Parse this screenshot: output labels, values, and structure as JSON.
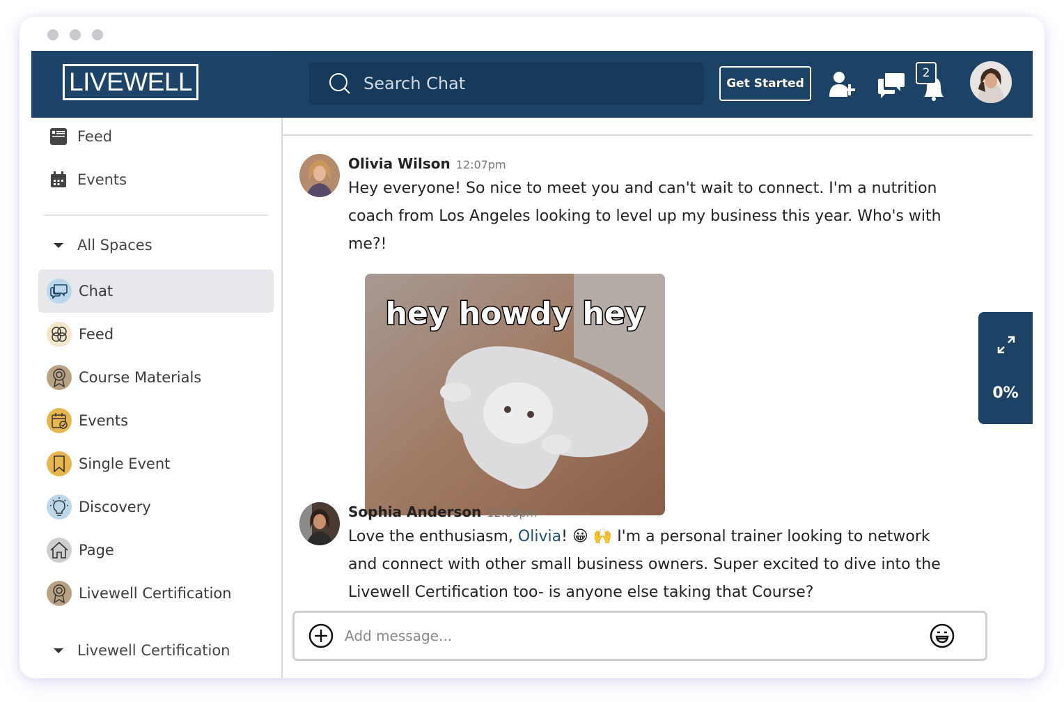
{
  "header": {
    "logo_text": "LIVEWELL",
    "search_placeholder": "Search Chat",
    "get_started_label": "Get Started",
    "notification_count": "2"
  },
  "sidebar": {
    "top_items": [
      {
        "label": "Feed",
        "icon": "newspaper-icon"
      },
      {
        "label": "Events",
        "icon": "calendar-icon"
      }
    ],
    "section_label": "All Spaces",
    "spaces": [
      {
        "label": "Chat",
        "icon": "chat-bubbles-icon",
        "active": true
      },
      {
        "label": "Feed",
        "icon": "clover-icon"
      },
      {
        "label": "Course Materials",
        "icon": "award-ribbon-icon"
      },
      {
        "label": "Events",
        "icon": "calendar-check-icon"
      },
      {
        "label": "Single Event",
        "icon": "bookmark-icon"
      },
      {
        "label": "Discovery",
        "icon": "lightbulb-icon"
      },
      {
        "label": "Page",
        "icon": "house-icon"
      },
      {
        "label": "Livewell Certification",
        "icon": "award-ribbon-icon"
      }
    ],
    "section2_label": "Livewell Certification"
  },
  "messages": [
    {
      "author": "Olivia Wilson",
      "time": "12:07pm",
      "text": "Hey everyone! So nice to meet you and can't wait to connect. I'm a nutrition coach from Los Angeles looking to level up my business this year. Who's with me?!",
      "gif_caption": "hey howdy hey"
    },
    {
      "author": "Sophia Anderson",
      "time": "12:08pm",
      "text_before": "Love the enthusiasm, ",
      "mention": "Olivia",
      "text_mid": "! ",
      "emoji": "😀 🙌",
      "text_after": " I'm a personal trainer looking to network and connect with other small business owners. Super excited to dive into the Livewell Certification too- is anyone else taking that Course?"
    }
  ],
  "progress_widget": {
    "percent_label": "0%",
    "value": 0
  },
  "composer": {
    "placeholder": "Add message..."
  },
  "colors": {
    "brand_navy": "#1c4266",
    "mention": "#1f4e79",
    "active_bg": "#e6e8ec"
  }
}
